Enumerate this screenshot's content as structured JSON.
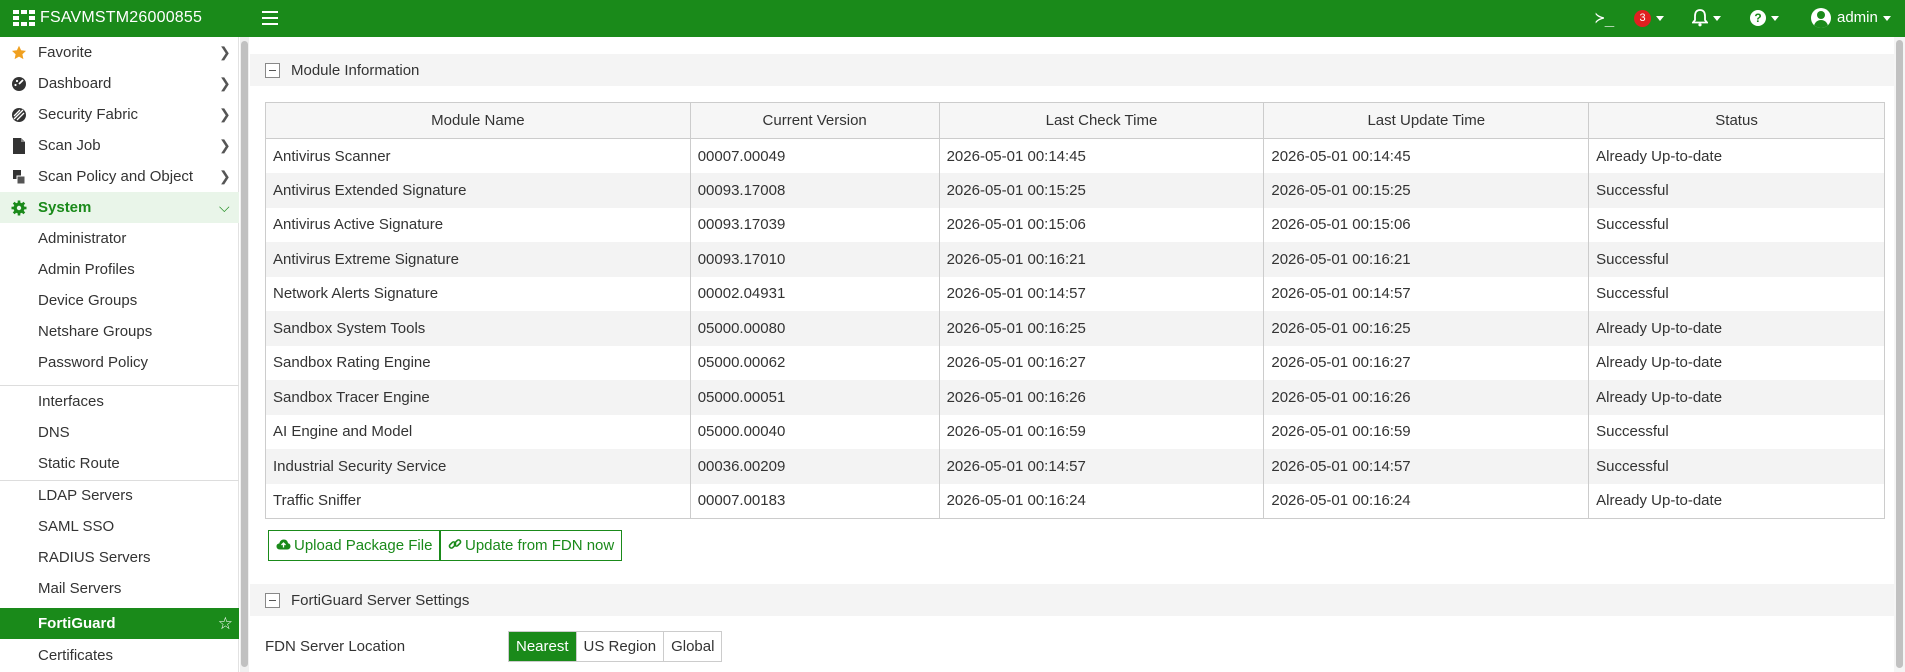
{
  "topbar": {
    "device_name": "FSAVMSTM26000855",
    "alert_count": "3",
    "user": "admin",
    "cli_glyph": "≻_",
    "help_glyph": "?"
  },
  "sidebar": {
    "items": [
      {
        "label": "Favorite",
        "icon": "star-icon"
      },
      {
        "label": "Dashboard",
        "icon": "dashboard-icon"
      },
      {
        "label": "Security Fabric",
        "icon": "fabric-icon"
      },
      {
        "label": "Scan Job",
        "icon": "document-icon"
      },
      {
        "label": "Scan Policy and Object",
        "icon": "policy-icon"
      },
      {
        "label": "System",
        "icon": "gear-icon"
      }
    ],
    "system_children": [
      "Administrator",
      "Admin Profiles",
      "Device Groups",
      "Netshare Groups",
      "Password Policy",
      "Interfaces",
      "DNS",
      "Static Route",
      "LDAP Servers",
      "SAML SSO",
      "RADIUS Servers",
      "Mail Servers",
      "FortiGuard",
      "Certificates"
    ]
  },
  "module_section": {
    "title": "Module Information",
    "columns": [
      "Module Name",
      "Current Version",
      "Last Check Time",
      "Last Update Time",
      "Status"
    ],
    "rows": [
      [
        "Antivirus Scanner",
        "00007.00049",
        "2026-05-01 00:14:45",
        "2026-05-01 00:14:45",
        "Already Up-to-date"
      ],
      [
        "Antivirus Extended Signature",
        "00093.17008",
        "2026-05-01 00:15:25",
        "2026-05-01 00:15:25",
        "Successful"
      ],
      [
        "Antivirus Active Signature",
        "00093.17039",
        "2026-05-01 00:15:06",
        "2026-05-01 00:15:06",
        "Successful"
      ],
      [
        "Antivirus Extreme Signature",
        "00093.17010",
        "2026-05-01 00:16:21",
        "2026-05-01 00:16:21",
        "Successful"
      ],
      [
        "Network Alerts Signature",
        "00002.04931",
        "2026-05-01 00:14:57",
        "2026-05-01 00:14:57",
        "Successful"
      ],
      [
        "Sandbox System Tools",
        "05000.00080",
        "2026-05-01 00:16:25",
        "2026-05-01 00:16:25",
        "Already Up-to-date"
      ],
      [
        "Sandbox Rating Engine",
        "05000.00062",
        "2026-05-01 00:16:27",
        "2026-05-01 00:16:27",
        "Already Up-to-date"
      ],
      [
        "Sandbox Tracer Engine",
        "05000.00051",
        "2026-05-01 00:16:26",
        "2026-05-01 00:16:26",
        "Already Up-to-date"
      ],
      [
        "AI Engine and Model",
        "05000.00040",
        "2026-05-01 00:16:59",
        "2026-05-01 00:16:59",
        "Successful"
      ],
      [
        "Industrial Security Service",
        "00036.00209",
        "2026-05-01 00:14:57",
        "2026-05-01 00:14:57",
        "Successful"
      ],
      [
        "Traffic Sniffer",
        "00007.00183",
        "2026-05-01 00:16:24",
        "2026-05-01 00:16:24",
        "Already Up-to-date"
      ]
    ],
    "upload_button": "Upload Package File",
    "update_button": "Update from FDN now"
  },
  "fortiguard_section": {
    "title": "FortiGuard Server Settings",
    "fdn_label": "FDN Server Location",
    "fdn_options": [
      "Nearest",
      "US Region",
      "Global"
    ],
    "fdn_selected": "Nearest"
  },
  "colors": {
    "brand_green": "#1a8a1a",
    "alert_red": "#e02020"
  }
}
